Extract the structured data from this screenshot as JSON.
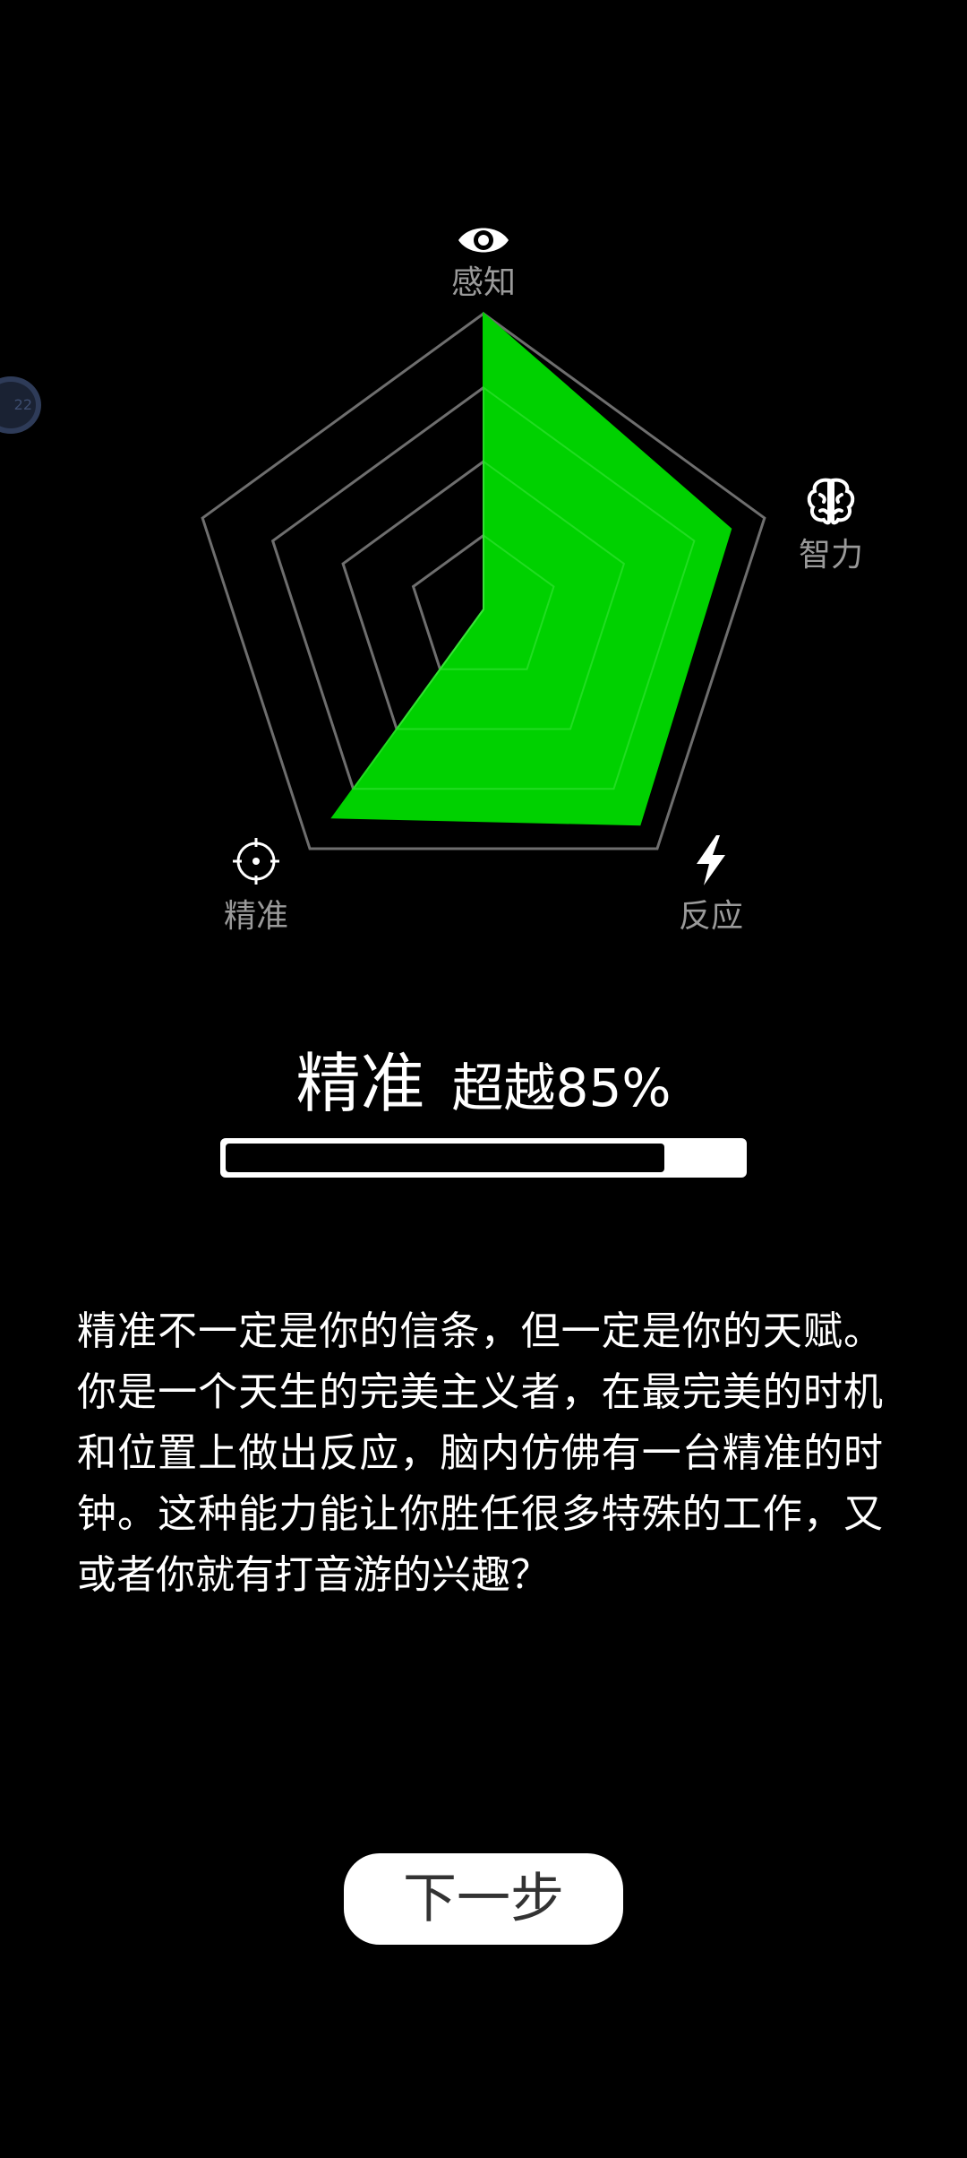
{
  "axes": [
    {
      "label": "感知",
      "icon": "eye-icon"
    },
    {
      "label": "智力",
      "icon": "brain-icon"
    },
    {
      "label": "反应",
      "icon": "lightning-icon"
    },
    {
      "label": "精准",
      "icon": "crosshair-icon"
    },
    {
      "label": "",
      "icon": ""
    }
  ],
  "chart_data": {
    "type": "radar",
    "categories": [
      "感知",
      "智力",
      "反应",
      "精准",
      ""
    ],
    "values": [
      1.0,
      0.88,
      0.9,
      0.87,
      0.0
    ],
    "max": 1.0,
    "grid_levels": 4,
    "fill_color": "#00d100",
    "grid_color": "#6e6e6e"
  },
  "result": {
    "title": "精准",
    "value_text": "超越85%",
    "percent": 85
  },
  "description": "精准不一定是你的信条，但一定是你的天赋。你是一个天生的完美主义者，在最完美的时机和位置上做出反应，脑内仿佛有一台精准的时钟。这种能力能让你胜任很多特殊的工作，又或者你就有打音游的兴趣？",
  "next_button": {
    "label": "下一步"
  },
  "floating_badge": {
    "text": "22"
  },
  "colors": {
    "background": "#000000",
    "accent": "#00d100",
    "button_bg": "#ffffff"
  }
}
